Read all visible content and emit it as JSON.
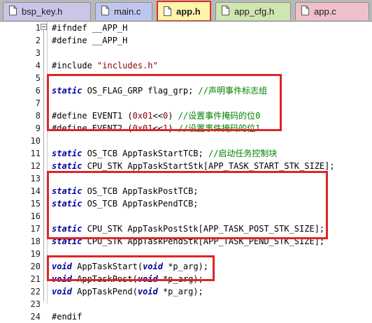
{
  "tabs": [
    {
      "label": "bsp_key.h",
      "active": false,
      "color": "#c9c6e8"
    },
    {
      "label": "main.c",
      "active": false,
      "color": "#bfc6ee"
    },
    {
      "label": "app.h",
      "active": true,
      "color": "#fff4a8"
    },
    {
      "label": "app_cfg.h",
      "active": false,
      "color": "#cfe6b0"
    },
    {
      "label": "app.c",
      "active": false,
      "color": "#efc0cc"
    }
  ],
  "lines": [
    {
      "num": "1",
      "text": "#ifndef __APP_H"
    },
    {
      "num": "2",
      "text": "#define __APP_H"
    },
    {
      "num": "3",
      "text": ""
    },
    {
      "num": "4",
      "text": "#include \"includes.h\""
    },
    {
      "num": "5",
      "text": ""
    },
    {
      "num": "6",
      "text": "static OS_FLAG_GRP flag_grp; //声明事件标志组"
    },
    {
      "num": "7",
      "text": ""
    },
    {
      "num": "8",
      "text": "#define EVENT1 (0x01<<0) //设置事件掩码的位0"
    },
    {
      "num": "9",
      "text": "#define EVENT2 (0x01<<1) //设置事件掩码的位1"
    },
    {
      "num": "10",
      "text": ""
    },
    {
      "num": "11",
      "text": "static OS_TCB AppTaskStartTCB; //启动任务控制块"
    },
    {
      "num": "12",
      "text": "static CPU_STK AppTaskStartStk[APP_TASK_START_STK_SIZE];"
    },
    {
      "num": "13",
      "text": ""
    },
    {
      "num": "14",
      "text": "static OS_TCB AppTaskPostTCB;"
    },
    {
      "num": "15",
      "text": "static OS_TCB AppTaskPendTCB;"
    },
    {
      "num": "16",
      "text": ""
    },
    {
      "num": "17",
      "text": "static CPU_STK AppTaskPostStk[APP_TASK_POST_STK_SIZE];"
    },
    {
      "num": "18",
      "text": "static CPU_STK AppTaskPendStk[APP_TASK_PEND_STK_SIZE];"
    },
    {
      "num": "19",
      "text": ""
    },
    {
      "num": "20",
      "text": "void AppTaskStart(void *p_arg);"
    },
    {
      "num": "21",
      "text": "void AppTaskPost(void *p_arg);"
    },
    {
      "num": "22",
      "text": "void AppTaskPend(void *p_arg);"
    },
    {
      "num": "23",
      "text": ""
    },
    {
      "num": "24",
      "text": "#endif"
    }
  ],
  "colors": {
    "keyword": "#0000a0",
    "comment": "#008000",
    "string": "#800000",
    "highlight_box": "#e02424"
  }
}
